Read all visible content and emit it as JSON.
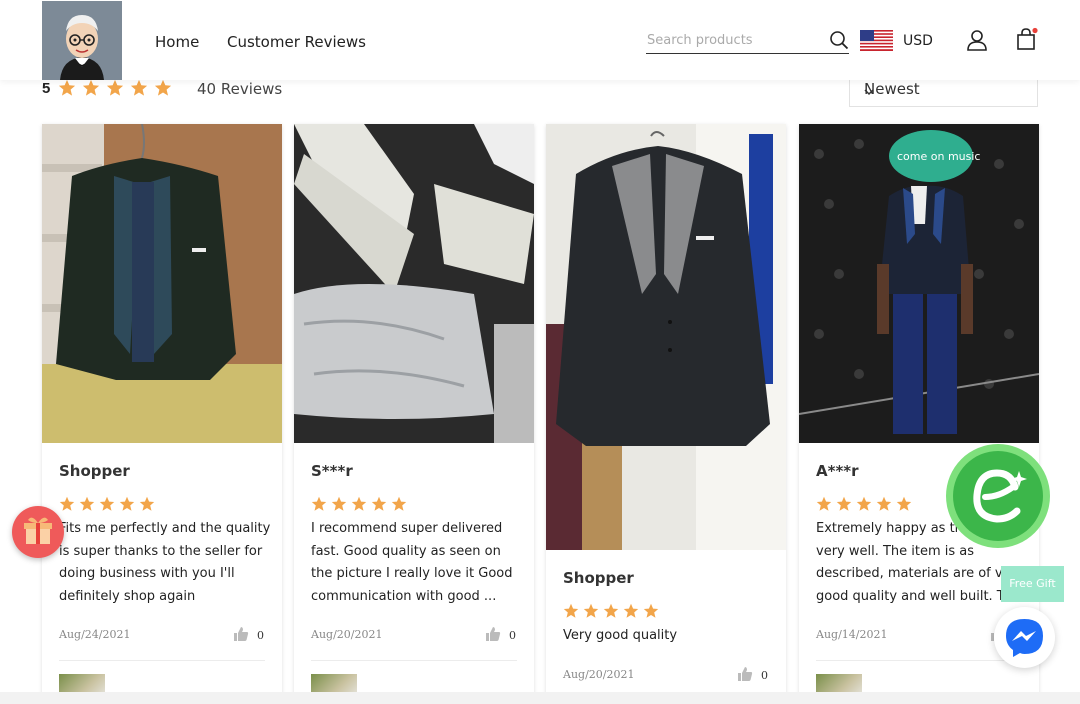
{
  "header": {
    "nav": [
      {
        "label": "Home"
      },
      {
        "label": "Customer Reviews"
      }
    ],
    "search": {
      "placeholder": "Search products"
    },
    "currency": "USD"
  },
  "summary": {
    "rating": "5",
    "star_count": 5,
    "reviews_count": "40 Reviews",
    "sort_value": "Newest"
  },
  "reviews": [
    {
      "name": "Shopper",
      "stars": 5,
      "text": "Fits me perfectly and the quality is super thanks to the seller for doing business with you I'll definitely shop again",
      "date": "Aug/24/2021",
      "likes": "0"
    },
    {
      "name": "S***r",
      "stars": 5,
      "text": "I recommend  super delivered fast. Good quality as seen on the picture I really love it  Good communication with good ...",
      "date": "Aug/20/2021",
      "likes": "0"
    },
    {
      "name": "Shopper",
      "stars": 5,
      "text": "Very good quality",
      "date": "Aug/20/2021",
      "likes": "0"
    },
    {
      "name": "A***r",
      "stars": 5,
      "text": "Extremely happy as they fit very well. The item is as described, materials are of very good quality and well built. Th",
      "date": "Aug/14/2021",
      "likes": "0"
    }
  ],
  "sticker_text": "come on music",
  "floating": {
    "free_gift_label": "Free Gift"
  },
  "colors": {
    "star": "#f2a54a",
    "accent_green": "#3cb64a",
    "messenger_blue": "#1e6cf6"
  }
}
